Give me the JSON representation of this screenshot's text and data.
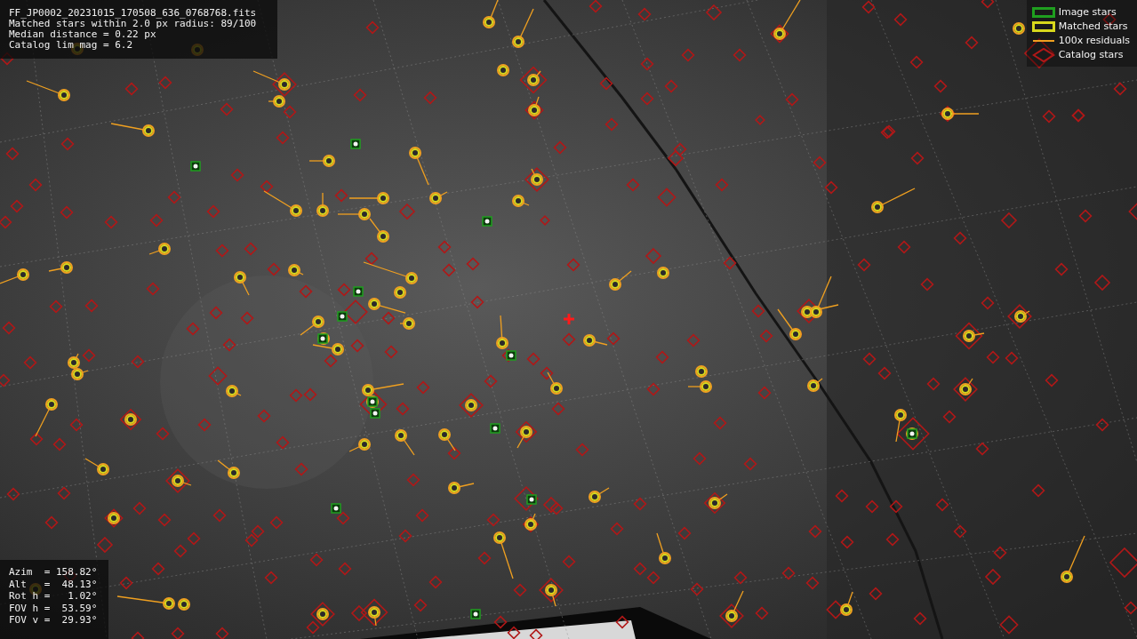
{
  "file_info": [
    "FF_JP0002_20231015_170508_636_0768768.fits",
    "Matched stars within 2.0 px radius: 89/100",
    "Median distance = 0.22 px",
    "Catalog lim mag = 6.2"
  ],
  "legend": [
    {
      "label": "Image stars",
      "color": "#1f9e1f"
    },
    {
      "kind": "matched",
      "label": "Matched stars",
      "color": "#d8d81c"
    },
    {
      "kind": "residual",
      "label": "100x residuals",
      "color": "#f0a020"
    },
    {
      "kind": "catalog",
      "label": "Catalog stars",
      "color": "#b01818"
    }
  ],
  "pointing": [
    "Azim  = 158.82°",
    "Alt   =  48.13°",
    "Rot h =   1.02°",
    "FOV h =  53.59°",
    "FOV v =  29.93°"
  ]
}
